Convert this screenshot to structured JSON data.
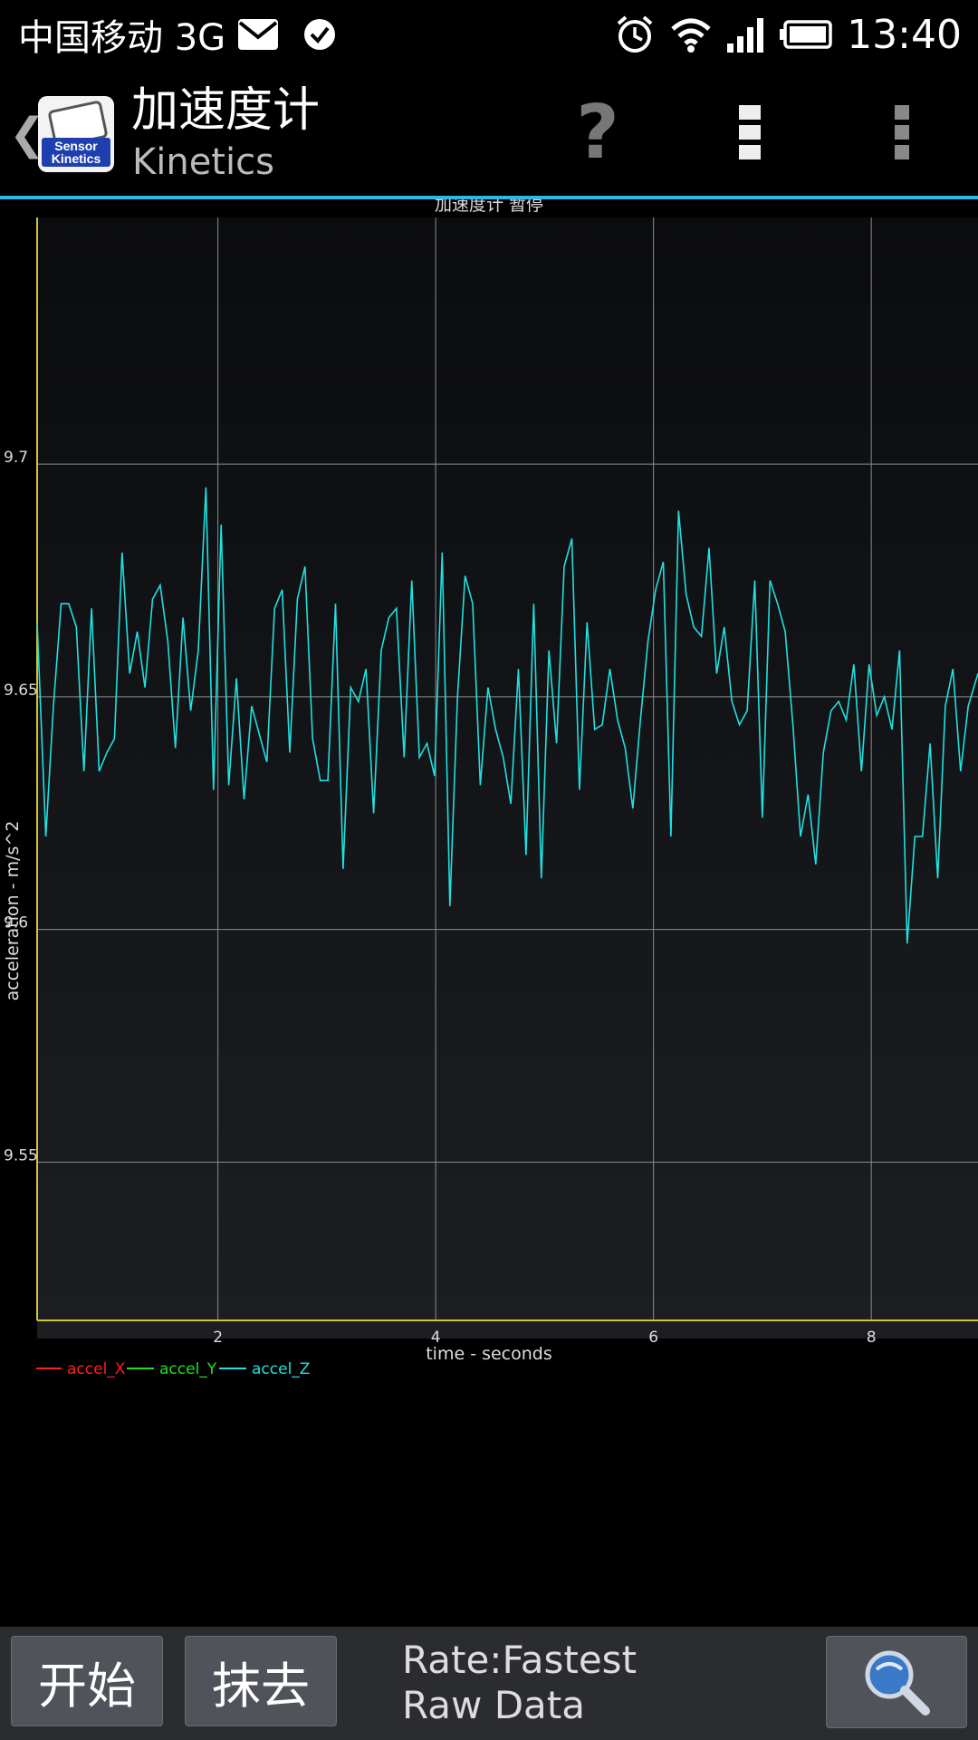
{
  "status_bar": {
    "carrier": "中国移动 3G",
    "time": "13:40",
    "icons": [
      "mail-icon",
      "check-circle-icon",
      "alarm-icon",
      "wifi-icon",
      "signal-icon",
      "battery-icon"
    ]
  },
  "action_bar": {
    "app_icon_text": "Sensor Kinetics",
    "title": "加速度计",
    "subtitle": "Kinetics",
    "help_label": "?"
  },
  "chart_data": {
    "type": "line",
    "title": "加速度计 暂停",
    "xlabel": "time - seconds",
    "ylabel": "acceleration - m/s^2",
    "xlim": [
      0.34,
      8.98
    ],
    "ylim": [
      9.516,
      9.753
    ],
    "x_ticks": [
      2,
      4,
      6,
      8
    ],
    "y_ticks": [
      9.55,
      9.6,
      9.65,
      9.7
    ],
    "x_tick_labels": [
      "2",
      "4",
      "6",
      "8"
    ],
    "y_tick_labels": [
      "9.55",
      "9.6",
      "9.65",
      "9.7"
    ],
    "grid": true,
    "legend_position": "bottom-left",
    "colors": {
      "accel_X": "#ff2020",
      "accel_Y": "#20e020",
      "accel_Z": "#20e0e0",
      "axis": "#d4c430",
      "grid": "#8a8c8f"
    },
    "series": [
      {
        "name": "accel_X",
        "x": [],
        "y": []
      },
      {
        "name": "accel_Y",
        "x": [],
        "y": []
      },
      {
        "name": "accel_Z",
        "x": [
          0.34,
          0.42,
          0.49,
          0.56,
          0.63,
          0.7,
          0.77,
          0.84,
          0.91,
          0.98,
          1.05,
          1.12,
          1.19,
          1.26,
          1.33,
          1.4,
          1.47,
          1.54,
          1.61,
          1.68,
          1.75,
          1.82,
          1.89,
          1.96,
          2.03,
          2.1,
          2.17,
          2.24,
          2.31,
          2.38,
          2.45,
          2.52,
          2.59,
          2.66,
          2.73,
          2.8,
          2.87,
          2.94,
          3.01,
          3.08,
          3.15,
          3.22,
          3.29,
          3.36,
          3.43,
          3.5,
          3.57,
          3.64,
          3.71,
          3.78,
          3.85,
          3.92,
          3.99,
          4.06,
          4.13,
          4.2,
          4.27,
          4.34,
          4.41,
          4.48,
          4.55,
          4.62,
          4.69,
          4.76,
          4.83,
          4.9,
          4.97,
          5.04,
          5.11,
          5.18,
          5.25,
          5.32,
          5.39,
          5.46,
          5.53,
          5.6,
          5.67,
          5.74,
          5.81,
          5.88,
          5.95,
          6.02,
          6.09,
          6.16,
          6.23,
          6.3,
          6.37,
          6.44,
          6.51,
          6.58,
          6.65,
          6.72,
          6.79,
          6.86,
          6.93,
          7.0,
          7.07,
          7.14,
          7.21,
          7.28,
          7.35,
          7.42,
          7.49,
          7.56,
          7.63,
          7.7,
          7.77,
          7.84,
          7.91,
          7.98,
          8.05,
          8.12,
          8.19,
          8.26,
          8.33,
          8.4,
          8.47,
          8.54,
          8.61,
          8.68,
          8.75,
          8.82,
          8.89,
          8.98
        ],
        "y": [
          9.666,
          9.62,
          9.648,
          9.67,
          9.67,
          9.665,
          9.634,
          9.669,
          9.634,
          9.638,
          9.641,
          9.681,
          9.655,
          9.664,
          9.652,
          9.671,
          9.674,
          9.662,
          9.639,
          9.667,
          9.647,
          9.66,
          9.695,
          9.63,
          9.687,
          9.631,
          9.654,
          9.628,
          9.648,
          9.642,
          9.636,
          9.669,
          9.673,
          9.638,
          9.671,
          9.678,
          9.641,
          9.632,
          9.632,
          9.67,
          9.613,
          9.652,
          9.649,
          9.656,
          9.625,
          9.66,
          9.667,
          9.669,
          9.637,
          9.675,
          9.637,
          9.64,
          9.633,
          9.681,
          9.605,
          9.65,
          9.676,
          9.67,
          9.631,
          9.652,
          9.643,
          9.637,
          9.627,
          9.656,
          9.616,
          9.67,
          9.611,
          9.66,
          9.64,
          9.678,
          9.684,
          9.63,
          9.666,
          9.643,
          9.644,
          9.656,
          9.645,
          9.639,
          9.626,
          9.645,
          9.662,
          9.673,
          9.679,
          9.62,
          9.69,
          9.672,
          9.665,
          9.663,
          9.682,
          9.655,
          9.665,
          9.649,
          9.644,
          9.647,
          9.675,
          9.624,
          9.675,
          9.67,
          9.664,
          9.644,
          9.62,
          9.629,
          9.614,
          9.638,
          9.647,
          9.649,
          9.645,
          9.657,
          9.634,
          9.657,
          9.646,
          9.65,
          9.643,
          9.66,
          9.597,
          9.62,
          9.62,
          9.64,
          9.611,
          9.648,
          9.656,
          9.634,
          9.648,
          9.655
        ]
      }
    ]
  },
  "bottom_bar": {
    "start_label": "开始",
    "clear_label": "抹去",
    "rate_text": "Rate:Fastest",
    "mode_text": "Raw Data"
  }
}
